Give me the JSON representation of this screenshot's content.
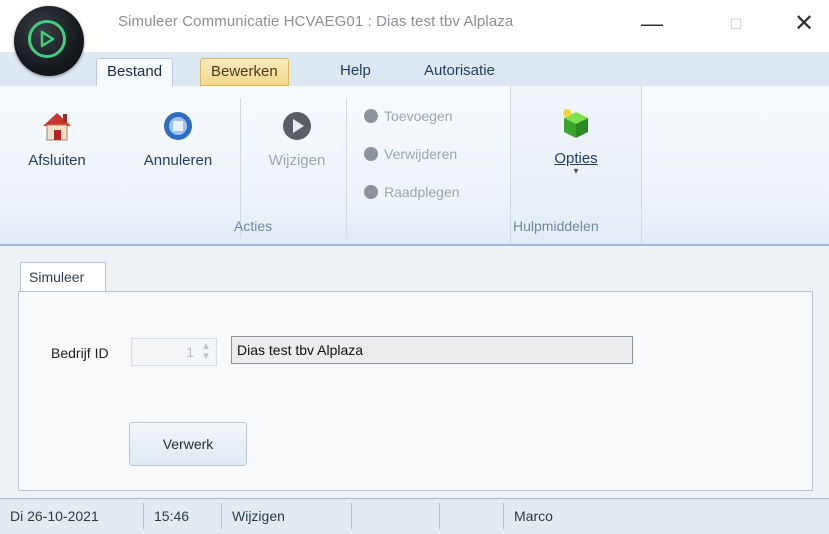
{
  "window": {
    "title": "Simuleer Communicatie HCVAEG01 : Dias test tbv Alplaza",
    "minimize_glyph": "—",
    "maximize_glyph": "☐",
    "close_glyph": "✕"
  },
  "menu": {
    "tabs": [
      {
        "label": "Bestand",
        "state": "active"
      },
      {
        "label": "Bewerken",
        "state": "hover"
      },
      {
        "label": "Help",
        "state": "normal"
      },
      {
        "label": "Autorisatie",
        "state": "normal"
      }
    ]
  },
  "ribbon": {
    "acties": {
      "group_label": "Acties",
      "afsluiten": {
        "label": "Afsluiten",
        "icon": "house-icon"
      },
      "annuleren": {
        "label": "Annuleren",
        "icon": "cancel-icon"
      },
      "wijzigen": {
        "label": "Wijzigen",
        "icon": "play-icon"
      },
      "toevoegen": {
        "label": "Toevoegen"
      },
      "verwijderen": {
        "label": "Verwijderen"
      },
      "raadplegen": {
        "label": "Raadplegen"
      }
    },
    "hulpmiddelen": {
      "group_label": "Hulpmiddelen",
      "opties": {
        "label": "Opties",
        "icon": "green-cube-icon",
        "dropdown_glyph": "▾"
      }
    }
  },
  "form": {
    "tab_label": "Simuleer",
    "bedrijf_id_label": "Bedrijf ID",
    "bedrijf_id_value": "1",
    "company_name_value": "Dias test tbv Alplaza",
    "verwerk_label": "Verwerk"
  },
  "statusbar": {
    "date": "Di 26-10-2021",
    "time": "15:46",
    "mode": "Wijzigen",
    "empty1": "",
    "empty2": "",
    "user": "Marco"
  },
  "colors": {
    "accent": "#3fd07a",
    "menu_text": "#1f3f66",
    "disabled_text": "#9aa6b3"
  }
}
